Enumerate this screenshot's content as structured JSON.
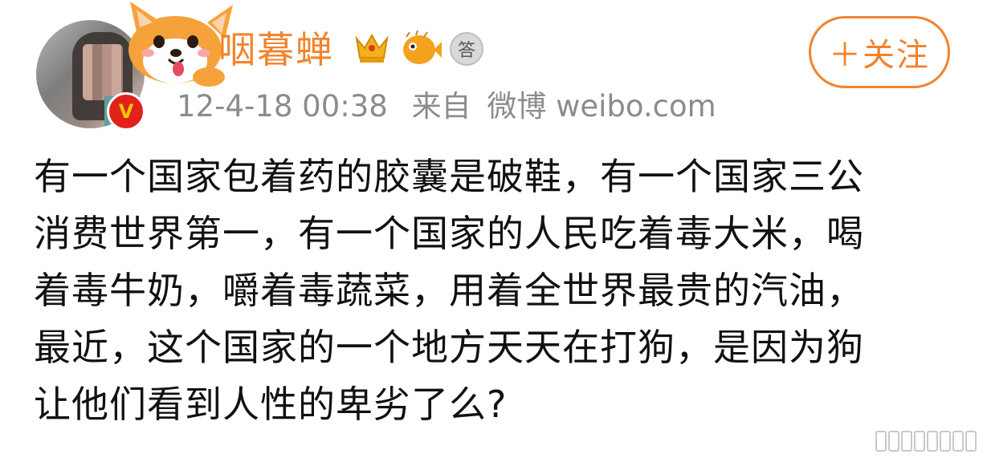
{
  "user": {
    "name": "咽暮蝉",
    "avatar_badge": "V"
  },
  "follow_button": {
    "label": "＋关注"
  },
  "meta": {
    "timestamp": "12-4-18 00:38",
    "source_prefix": "来自",
    "source_name": "微博 weibo.com"
  },
  "post": {
    "lines": [
      "有一个国家包着药的胶囊是破鞋，有一个国家三公",
      "消费世界第一，有一个国家的人民吃着毒大米，喝",
      "着毒牛奶，嚼着毒蔬菜，用着全世界最贵的汽油，",
      "最近，这个国家的一个地方天天在打狗，是因为狗",
      "让他们看到人性的卑劣了么?"
    ]
  },
  "icons": {
    "mascot": "corgi-sticker-icon",
    "crown": "gold-crown-badge-icon",
    "fish": "pufferfish-badge-icon",
    "answer": "answer-badge-icon"
  },
  "colors": {
    "accent": "#f2832c",
    "meta": "#8c8c8c",
    "vip": "#e0221b"
  },
  "answer_badge_text": "答"
}
